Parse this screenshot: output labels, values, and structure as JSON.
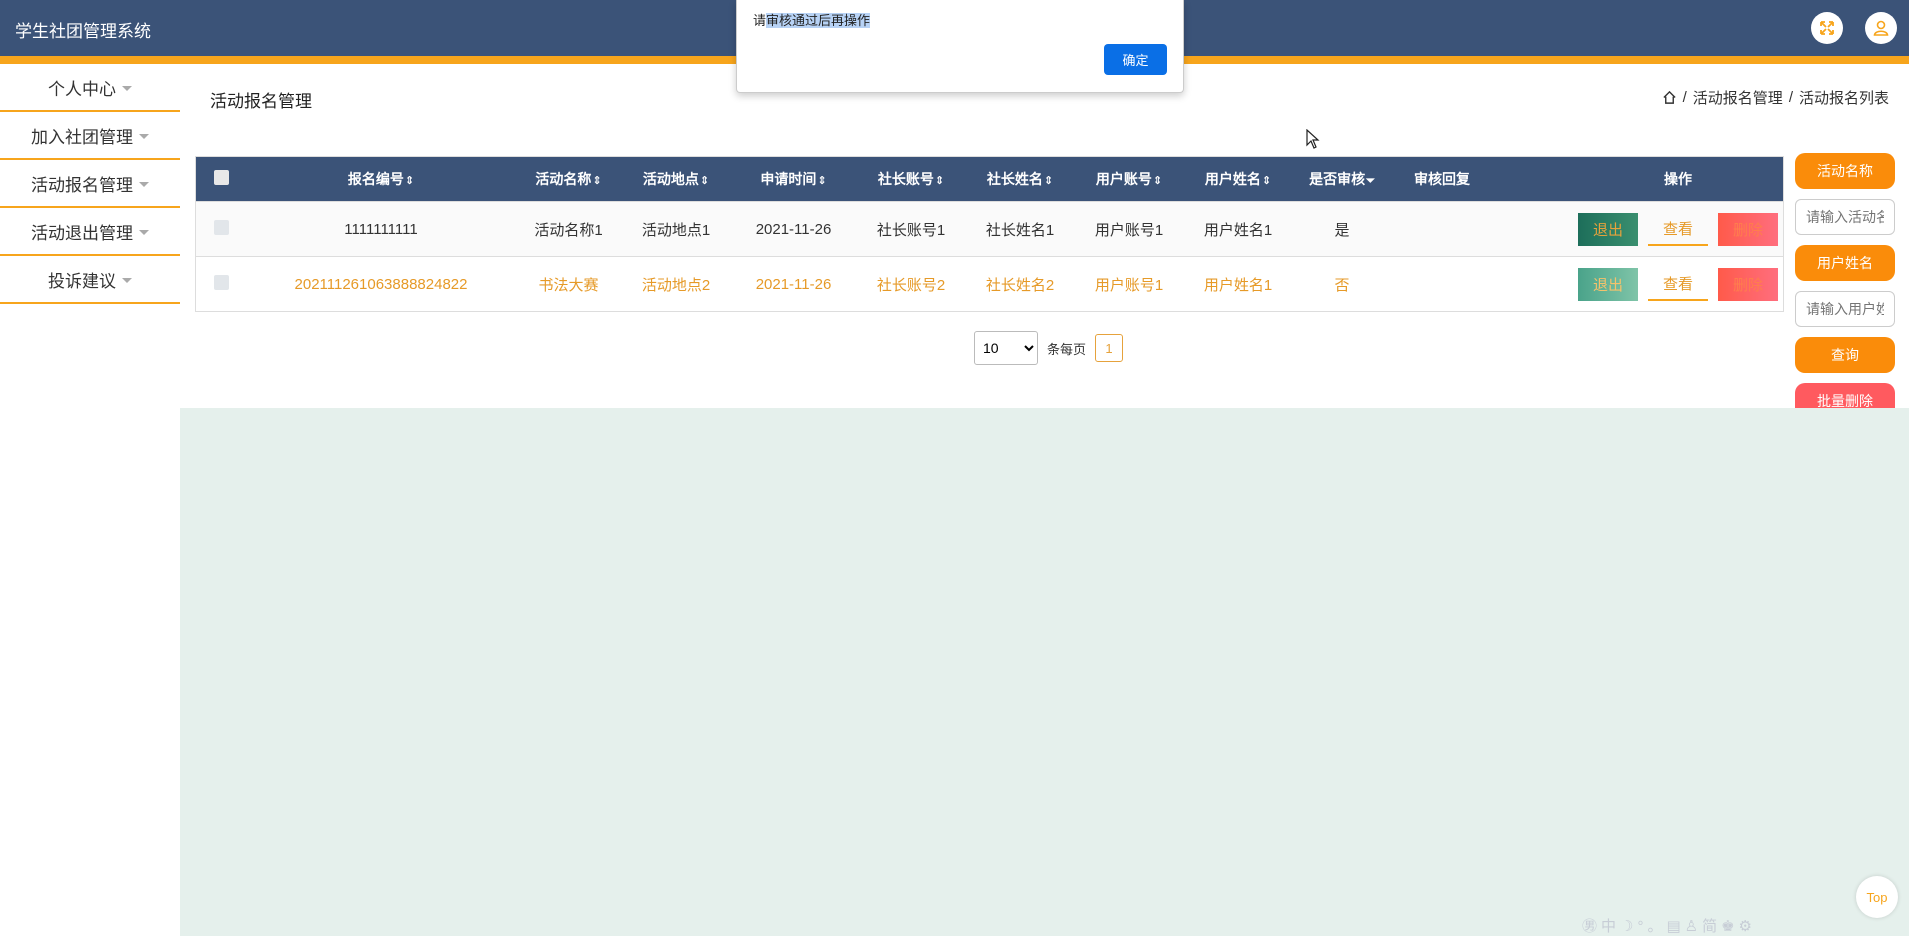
{
  "app": {
    "title": "学生社团管理系统"
  },
  "sidebar": {
    "items": [
      {
        "label": "个人中心"
      },
      {
        "label": "加入社团管理"
      },
      {
        "label": "活动报名管理"
      },
      {
        "label": "活动退出管理"
      },
      {
        "label": "投诉建议"
      }
    ]
  },
  "main": {
    "title": "活动报名管理",
    "breadcrumb": [
      "活动报名管理",
      "活动报名列表"
    ],
    "breadcrumb_sep": "/"
  },
  "table": {
    "columns": [
      "报名编号",
      "活动名称",
      "活动地点",
      "申请时间",
      "社长账号",
      "社长姓名",
      "用户账号",
      "用户姓名",
      "是否审核",
      "审核回复",
      "操作"
    ],
    "sort_up_down": "⇕",
    "sort_down": "⏷",
    "rows": [
      {
        "id": "1111111111",
        "activity": "活动名称1",
        "location": "活动地点1",
        "date": "2021-11-26",
        "leader_acc": "社长账号1",
        "leader_name": "社长姓名1",
        "user_acc": "用户账号1",
        "user_name": "用户姓名1",
        "audited": "是",
        "reply": ""
      },
      {
        "id": "20211126106388882482​2",
        "activity": "书法大赛",
        "location": "活动地点2",
        "date": "2021-11-26",
        "leader_acc": "社长账号2",
        "leader_name": "社长姓名2",
        "user_acc": "用户账号1",
        "user_name": "用户姓名1",
        "audited": "否",
        "reply": ""
      }
    ],
    "actions": {
      "exit": "退出",
      "view": "查看",
      "delete": "删除"
    }
  },
  "pager": {
    "page_size": "10",
    "per_page_label": "条每页",
    "current_page": "1",
    "options": [
      "10"
    ]
  },
  "search": {
    "activity_label": "活动名称",
    "activity_placeholder": "请输入活动名称",
    "user_label": "用户姓名",
    "user_placeholder": "请输入用户姓名",
    "query": "查询",
    "batch_delete": "批量删除"
  },
  "dialog": {
    "prefix": "请",
    "selected": "审核通过后再操作",
    "ok": "确定"
  },
  "top_button": "Top",
  "ime_bar": "㊚中☽°。▤♙简♚⚙",
  "colors": {
    "header": "#3b5378",
    "accent": "#f7a51c",
    "orange": "#fa8c0a",
    "danger": "#ff5a5f",
    "dialog_ok": "#0a6fe6"
  }
}
